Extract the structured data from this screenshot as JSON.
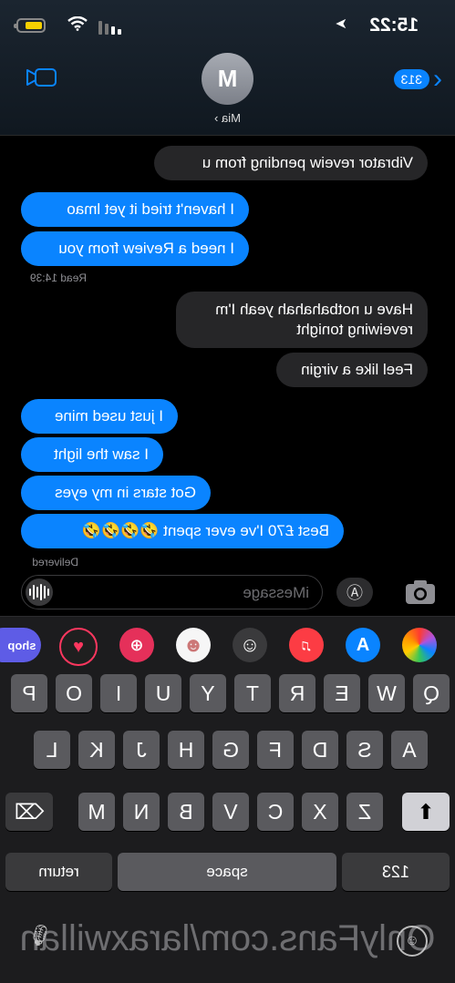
{
  "status_bar": {
    "time": "15:22",
    "location_arrow": "location-arrow-icon"
  },
  "header": {
    "unread_badge": "313",
    "avatar_initial": "M",
    "contact_name": "Mia ›"
  },
  "messages": [
    {
      "side": "in",
      "text": "Vibrator reveiw pending from u"
    },
    {
      "side": "out",
      "text": "I haven't tried it yet lmao"
    },
    {
      "side": "out",
      "text": "I need a Review from you"
    },
    {
      "side": "in",
      "text": "Have u notbahahah yeah I'm"
    },
    {
      "side": "in",
      "text": "reveiwing tonight"
    },
    {
      "side": "in",
      "text": "Feel like a virgin"
    },
    {
      "side": "out",
      "text": "I just used mine"
    },
    {
      "side": "out",
      "text": "I saw the light"
    },
    {
      "side": "out",
      "text": "Got stars in my eyes"
    },
    {
      "side": "out",
      "text": "Best £70 I've ever spent 🤣🤣🤣🤣"
    }
  ],
  "read_receipt": "Read 14:39",
  "delivered_label": "Delivered",
  "composer": {
    "placeholder": "iMessage"
  },
  "app_strip": [
    "photos",
    "app-store",
    "music",
    "memoji",
    "memoji-2",
    "search-web",
    "heart-digital-touch",
    "shop"
  ],
  "shop_label": "shop",
  "keyboard": {
    "row1": [
      "Q",
      "W",
      "E",
      "R",
      "T",
      "Y",
      "U",
      "I",
      "O",
      "P"
    ],
    "row2": [
      "A",
      "S",
      "D",
      "F",
      "G",
      "H",
      "J",
      "K",
      "L"
    ],
    "row3": [
      "Z",
      "X",
      "C",
      "V",
      "B",
      "N",
      "M"
    ],
    "numbers_key": "123",
    "space_key": "space",
    "return_key": "return"
  },
  "watermark": "OnlyFans.com/laraxwillan",
  "colors": {
    "outgoing": "#0a84ff",
    "incoming": "#262628",
    "background": "#000000"
  }
}
